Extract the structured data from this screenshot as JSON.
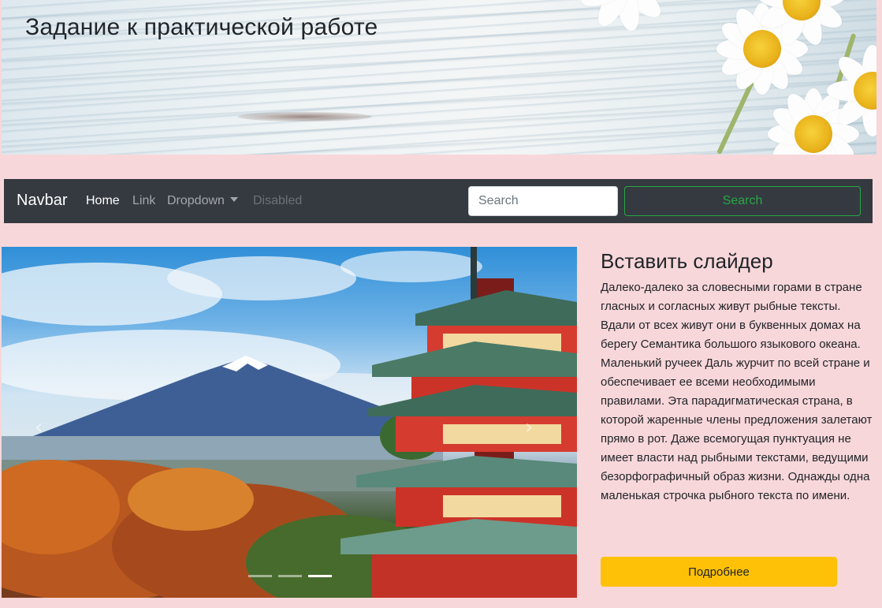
{
  "header": {
    "title": "Задание к практической работе"
  },
  "navbar": {
    "brand": "Navbar",
    "items": [
      {
        "label": "Home"
      },
      {
        "label": "Link"
      },
      {
        "label": "Dropdown"
      },
      {
        "label": "Disabled"
      }
    ],
    "search": {
      "placeholder": "Search",
      "value": "",
      "button_label": "Search"
    }
  },
  "carousel": {
    "prev_icon": "chevron-left-icon",
    "next_icon": "chevron-right-icon",
    "prev_glyph": "‹",
    "next_glyph": "›",
    "slide_count": 3,
    "active_index": 2
  },
  "side": {
    "title": "Вставить слайдер",
    "text": "Далеко-далеко за словесными горами в стране гласных и согласных живут рыбные тексты. Вдали от всех живут они в буквенных домах на берегу Семантика большого языкового океана. Маленький ручеек Даль журчит по всей стране и обеспечивает ее всеми необходимыми правилами. Эта парадигматическая страна, в которой жаренные члены предложения залетают прямо в рот. Даже всемогущая пунктуация не имеет власти над рыбными текстами, ведущими безорфографичный образ жизни. Однажды одна маленькая строчка рыбного текста по имени.",
    "button_label": "Подробнее"
  },
  "colors": {
    "page_background": "#f8d7da",
    "navbar": "#343a40",
    "search_button": "#28a745",
    "more_button": "#ffc107"
  }
}
